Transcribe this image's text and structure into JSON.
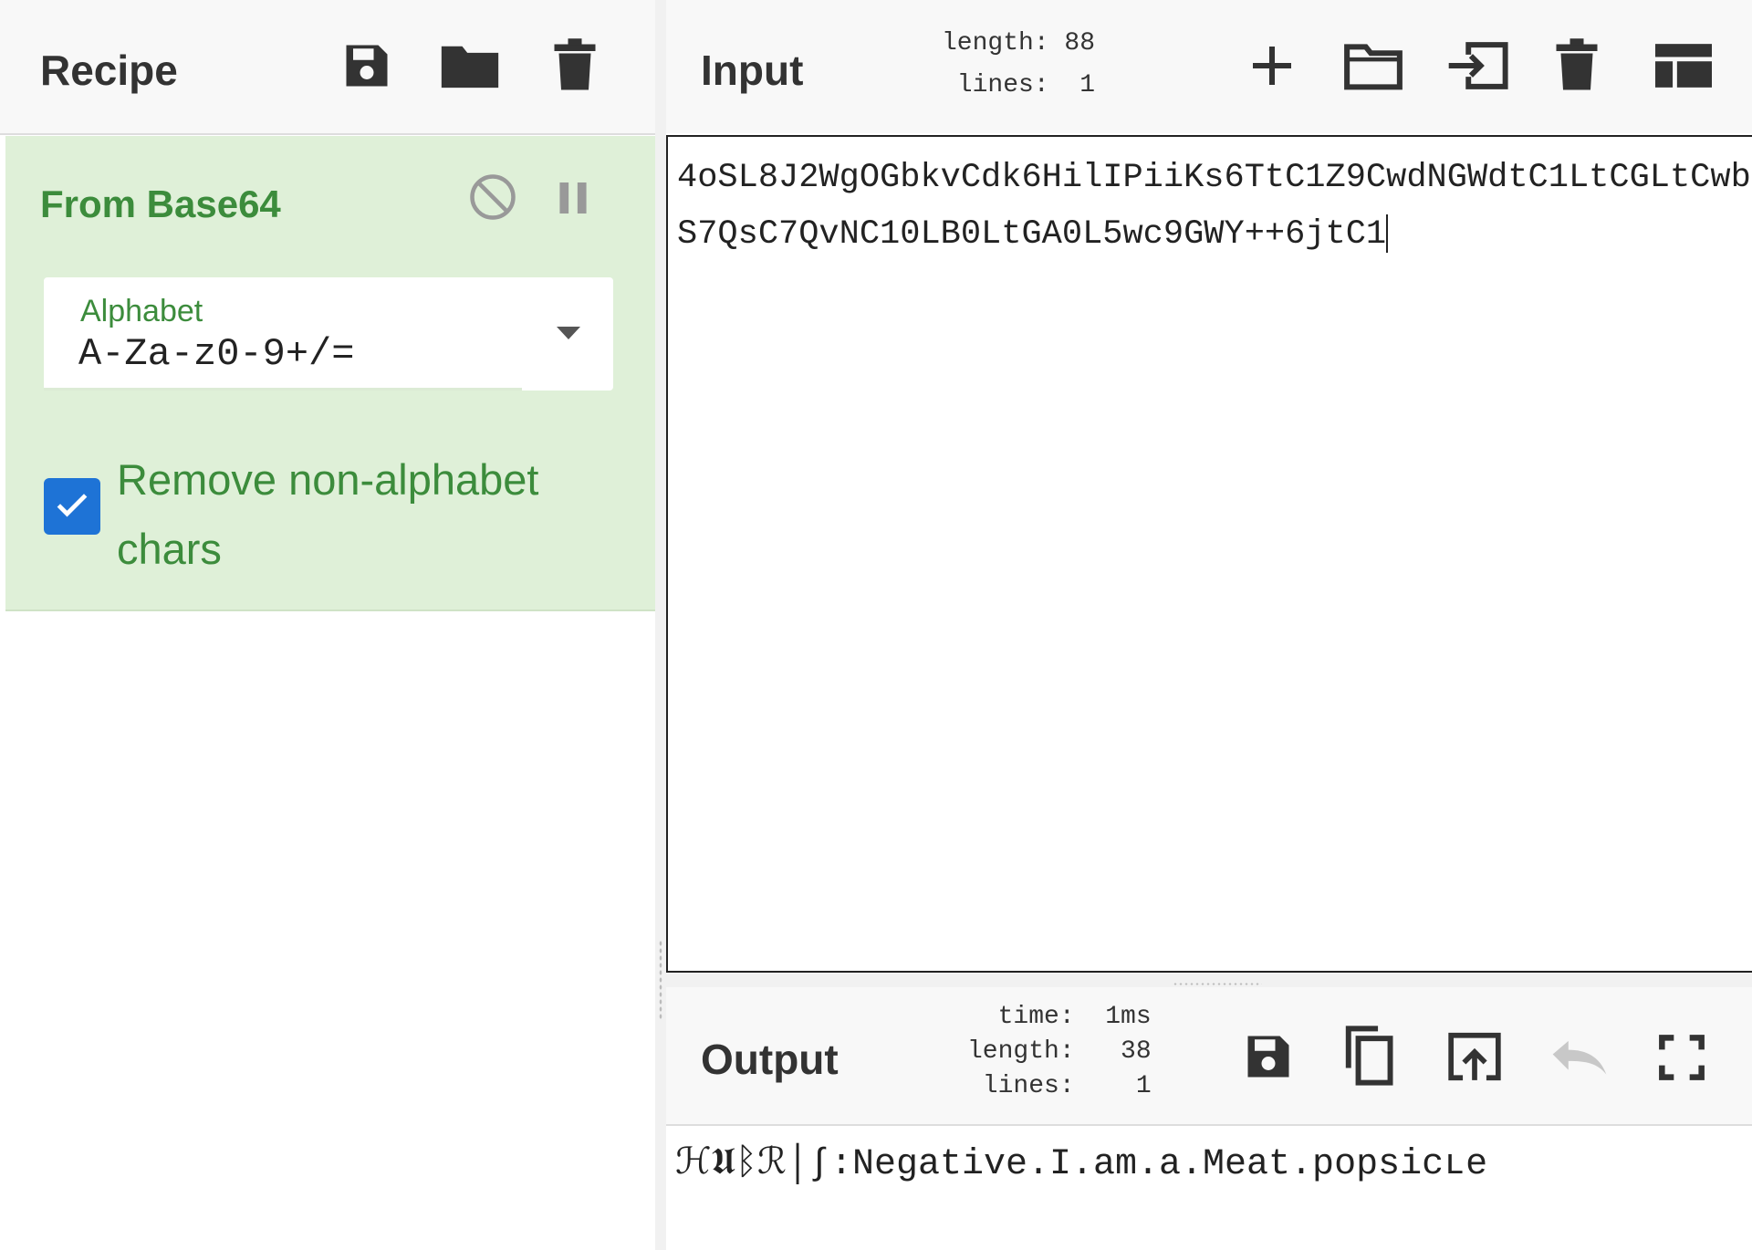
{
  "recipe": {
    "title": "Recipe",
    "icons": [
      "save-icon",
      "folder-icon",
      "trash-icon"
    ],
    "operation": {
      "name": "From Base64",
      "alphabet_label": "Alphabet",
      "alphabet_value": "A-Za-z0-9+/=",
      "remove_label": "Remove non-alphabet chars",
      "remove_checked": true
    }
  },
  "input": {
    "title": "Input",
    "stats": "length: 88\n lines:  1",
    "text": "4oSL8J2WgOGbkvCdk6HilIPiiKs6TtC1Z9CwdNGWdtC1LtCGLtCwbS7QsC7QvNC10LB0LtGA0L5wc9GWY++6jtC1",
    "icons": [
      "plus-icon",
      "folder-icon",
      "input-file-icon",
      "trash-icon",
      "layout-icon"
    ]
  },
  "output": {
    "title": "Output",
    "stats": "  time:  1ms\nlength:   38\n lines:    1",
    "text": "ℋ𝖀ᛒℛ│∫:Negative.I.am.a.Meat.popsicʟe",
    "icons": [
      "save-icon",
      "copy-icon",
      "replace-input-icon",
      "undo-icon",
      "maximize-icon"
    ]
  },
  "colors": {
    "accent_green": "#3c8c3c",
    "card_green": "#dff0d8",
    "checkbox_blue": "#1e73d6",
    "icon_dark": "#333333",
    "icon_disabled": "#c8c8c8"
  }
}
